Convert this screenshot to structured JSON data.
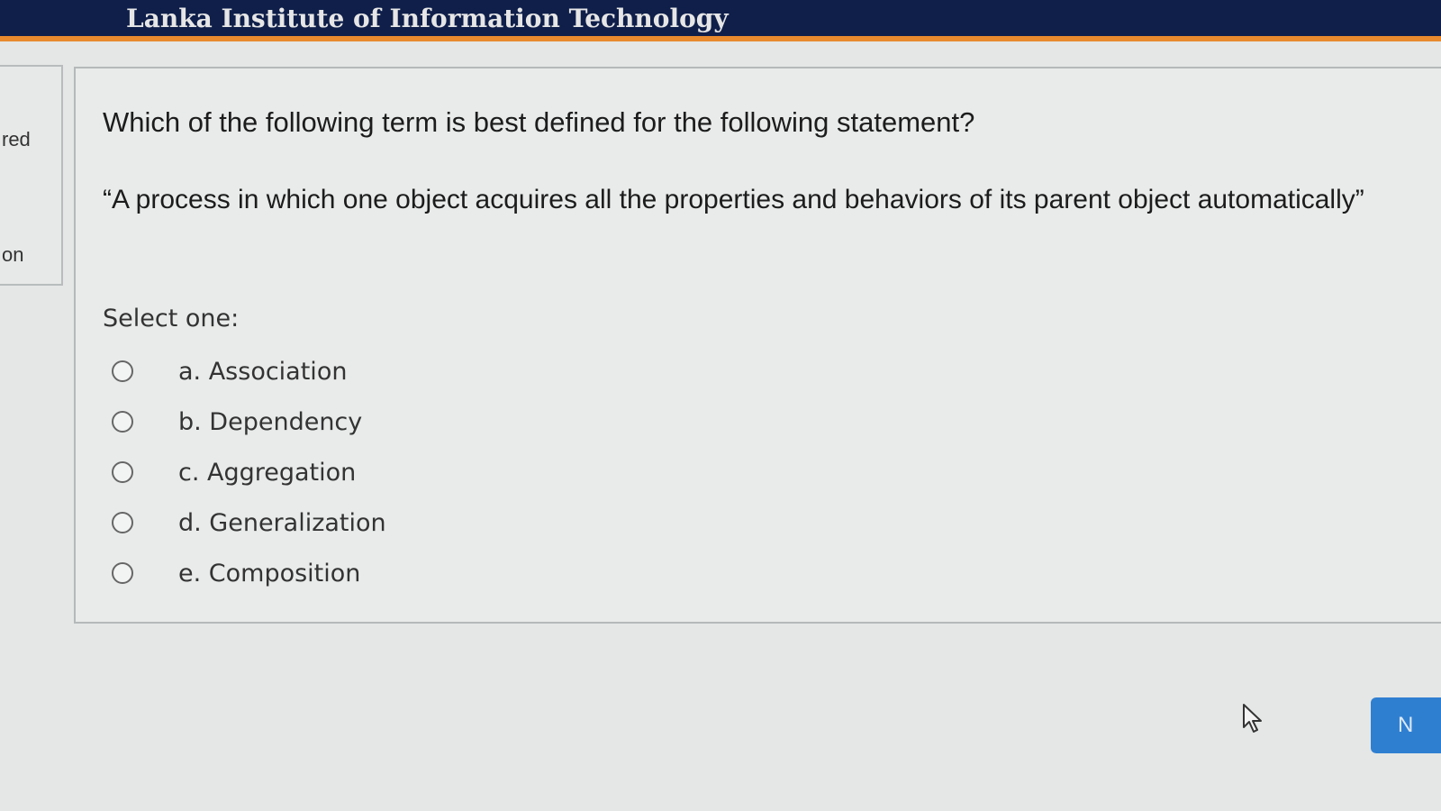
{
  "header": {
    "title": "Lanka Institute of Information Technology"
  },
  "sidebar": {
    "fragment_top": "red",
    "fragment_bottom": "on"
  },
  "question": {
    "text": "Which of the following term is best defined for the following statement?",
    "statement": "“A process in which one object acquires all the properties and behaviors of its parent object automatically”",
    "prompt": "Select one:",
    "options": [
      {
        "label": "a. Association",
        "selected": false
      },
      {
        "label": "b. Dependency",
        "selected": false
      },
      {
        "label": "c. Aggregation",
        "selected": false
      },
      {
        "label": "d. Generalization",
        "selected": false
      },
      {
        "label": "e. Composition",
        "selected": false
      }
    ]
  },
  "navigation": {
    "next_label": "N"
  },
  "colors": {
    "header_bg": "#0f1f4a",
    "header_accent": "#e98a2e",
    "button_blue": "#2f7fd1"
  }
}
